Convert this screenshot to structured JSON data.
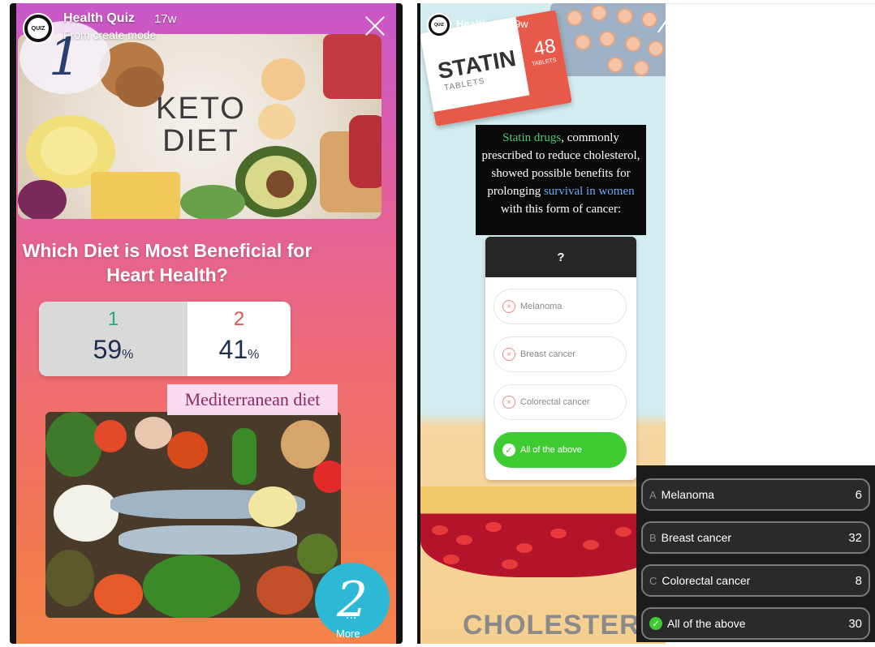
{
  "left_story": {
    "account": "Health Quiz",
    "time": "17w",
    "subtitle": "From create mode",
    "avatar_text": "QUIZ",
    "badge_top": "1",
    "keto_text": "KETO\nDIET",
    "question": "Which Diet is Most Beneficial for Heart Health?",
    "poll": {
      "options": [
        {
          "label": "1",
          "percent_value": "59",
          "percent_sign": "%",
          "color": "#27a87f"
        },
        {
          "label": "2",
          "percent_value": "41",
          "percent_sign": "%",
          "color": "#e0524f"
        }
      ],
      "leading_fraction": 0.59
    },
    "mediterranean_label": "Mediterranean diet",
    "badge_bottom": "2",
    "more_label": "More",
    "more_dots": "..."
  },
  "right_story": {
    "account": "Health Quiz",
    "time": "9w",
    "avatar_text": "QUIZ",
    "box_brand": "STATIN",
    "box_sub": "TABLETS",
    "box_count": "48",
    "box_count_sub": "TABLETS",
    "question_parts": {
      "highlight_1": "Statin drugs",
      "text_1": ", commonly prescribed to reduce cholesterol, showed possible benefits for prolonging ",
      "highlight_2": "survival in women",
      "text_2": " with this form of cancer:"
    },
    "quiz_header": "?",
    "quiz_options": [
      {
        "label": "Melanoma",
        "correct": false
      },
      {
        "label": "Breast cancer",
        "correct": false
      },
      {
        "label": "Colorectal cancer",
        "correct": false
      },
      {
        "label": "All of the above",
        "correct": true
      }
    ],
    "bottom_word": "CHOLESTEROL"
  },
  "results": [
    {
      "letter": "A",
      "label": "Melanoma",
      "count": "6",
      "correct": false
    },
    {
      "letter": "B",
      "label": "Breast cancer",
      "count": "32",
      "correct": false
    },
    {
      "letter": "C",
      "label": "Colorectal cancer",
      "count": "8",
      "correct": false
    },
    {
      "letter": "",
      "label": "All of the above",
      "count": "30",
      "correct": true
    }
  ],
  "colors": {
    "correct_green": "#3ecb32",
    "accent_green_text": "#4cc96c",
    "accent_blue_text": "#6aa9f5",
    "poll_text": "#1d2f4d"
  },
  "icons": [
    "close-icon",
    "check-icon",
    "x-circle-icon",
    "quiz-avatar-icon"
  ]
}
